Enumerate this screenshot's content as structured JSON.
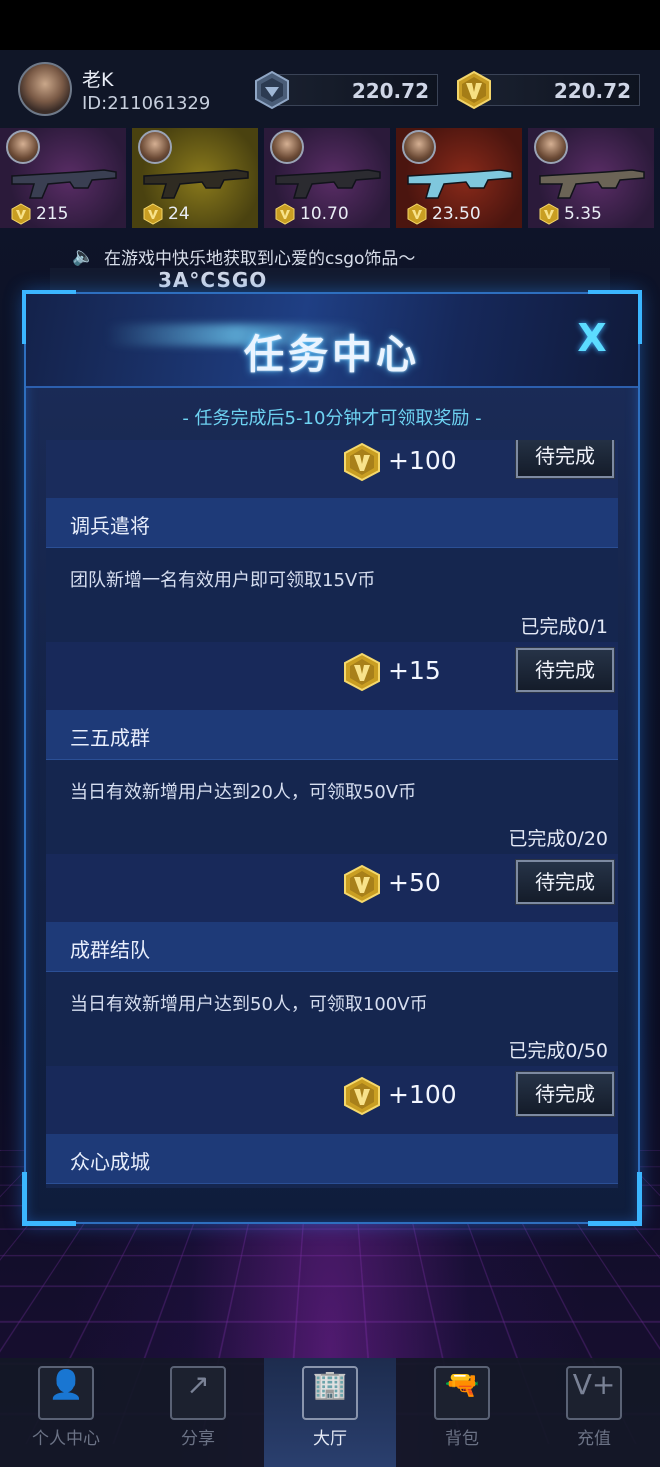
{
  "user": {
    "name": "老K",
    "id": "ID:211061329"
  },
  "balances": {
    "diamond": "220.72",
    "coin": "220.72"
  },
  "items": [
    {
      "price": "215",
      "theme": "purple"
    },
    {
      "price": "24",
      "theme": "gold"
    },
    {
      "price": "10.70",
      "theme": "purple"
    },
    {
      "price": "23.50",
      "theme": "red"
    },
    {
      "price": "5.35",
      "theme": "purple"
    }
  ],
  "marquee": {
    "text": "在游戏中快乐地获取到心爱的csgo饰品～",
    "logo": "3A°CSGO"
  },
  "dialog": {
    "title": "任务中心",
    "close": "X",
    "notice": "- 任务完成后5-10分钟才可领取奖励 -",
    "top_reward": {
      "reward": "+100",
      "status": "待完成"
    },
    "tasks": [
      {
        "title": "调兵遣将",
        "desc": "团队新增一名有效用户即可领取15V币",
        "progress": "已完成0/1",
        "reward": "+15",
        "status": "待完成"
      },
      {
        "title": "三五成群",
        "desc": "当日有效新增用户达到20人，可领取50V币",
        "progress": "已完成0/20",
        "reward": "+50",
        "status": "待完成"
      },
      {
        "title": "成群结队",
        "desc": "当日有效新增用户达到50人，可领取100V币",
        "progress": "已完成0/50",
        "reward": "+100",
        "status": "待完成"
      },
      {
        "title": "众心成城"
      }
    ]
  },
  "nav": [
    {
      "label": "个人中心",
      "icon": "person-icon"
    },
    {
      "label": "分享",
      "icon": "share-icon"
    },
    {
      "label": "大厅",
      "icon": "building-icon",
      "active": true
    },
    {
      "label": "背包",
      "icon": "gun-icon"
    },
    {
      "label": "充值",
      "icon": "recharge-icon"
    }
  ],
  "colors": {
    "accent": "#3bb6ff",
    "gold": "#d9b23a",
    "notice": "#6ed3f2"
  }
}
